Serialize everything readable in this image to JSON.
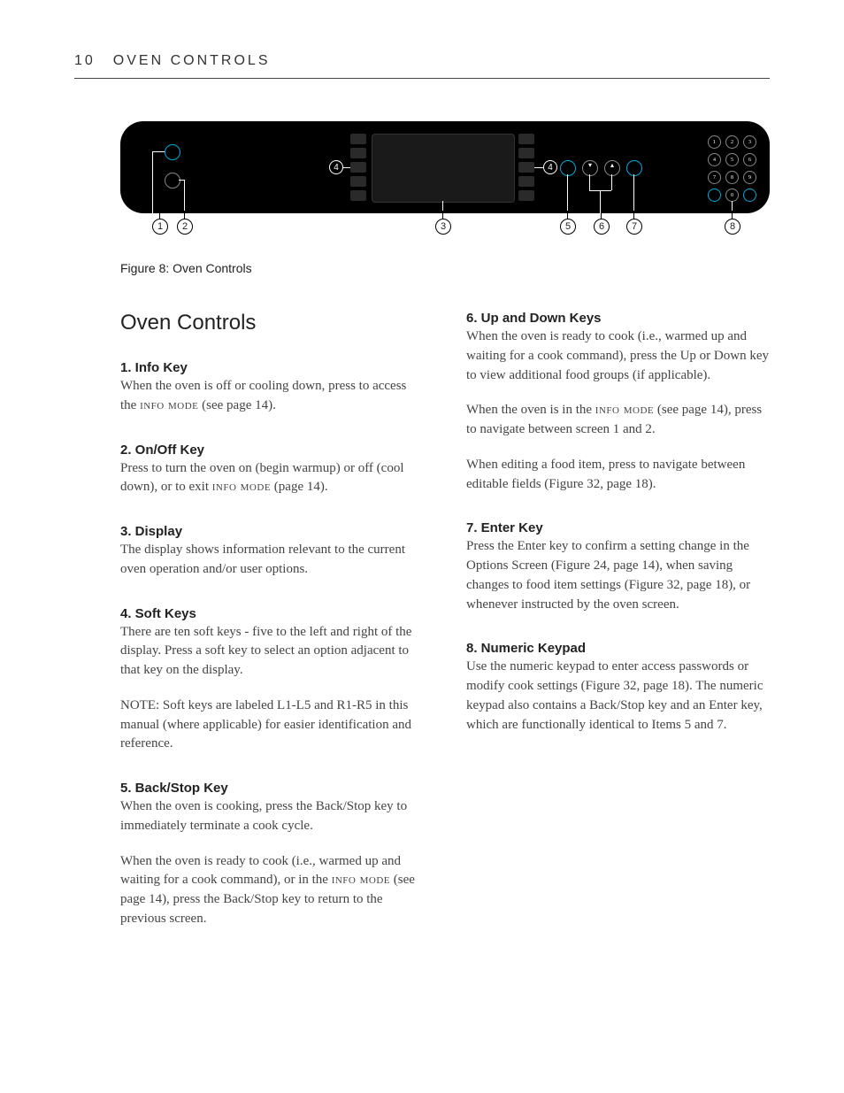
{
  "header": {
    "page_number": "10",
    "section": "OVEN CONTROLS"
  },
  "figure": {
    "caption": "Figure 8: Oven Controls",
    "callouts": [
      "1",
      "2",
      "3",
      "4",
      "4",
      "5",
      "6",
      "7",
      "8"
    ],
    "keypad": [
      "1",
      "2",
      "3",
      "4",
      "5",
      "6",
      "7",
      "8",
      "9",
      "",
      "0",
      ""
    ]
  },
  "title": "Oven Controls",
  "left": [
    {
      "head": "1. Info Key",
      "paras": [
        "When the oven is off or cooling down, press to access the INFO MODE (see page 14)."
      ]
    },
    {
      "head": "2. On/Off Key",
      "paras": [
        "Press to turn the oven on (begin warmup) or off (cool down), or to exit INFO MODE (page 14)."
      ]
    },
    {
      "head": "3. Display",
      "paras": [
        "The display shows information relevant to the current oven operation and/or user options."
      ]
    },
    {
      "head": "4. Soft Keys",
      "paras": [
        "There are ten soft keys - five to the left and right of the display. Press a soft key to select an option adjacent to that key on the display.",
        "NOTE: Soft keys are labeled L1-L5 and R1-R5 in this manual (where applicable) for easier identification and reference."
      ]
    },
    {
      "head": "5. Back/Stop Key",
      "paras": [
        "When the oven is cooking, press the Back/Stop key to immediately terminate a cook cycle.",
        "When the oven is ready to cook (i.e., warmed up and waiting for a cook command), or in the INFO MODE (see page 14), press the Back/Stop key to return to the previous screen."
      ]
    }
  ],
  "right": [
    {
      "head": "6. Up and Down Keys",
      "paras": [
        "When the oven is ready to cook (i.e., warmed up and waiting for a cook command), press the Up or Down key to view additional food groups (if applicable).",
        "When the oven is in the INFO MODE (see page 14), press to navigate between screen 1 and 2.",
        "When editing a food item, press to navigate between editable fields (Figure 32, page 18)."
      ]
    },
    {
      "head": "7. Enter Key",
      "paras": [
        "Press the Enter key to confirm a setting change in the Options Screen (Figure 24, page 14), when saving changes to food item settings (Figure 32, page 18), or whenever instructed by the oven screen."
      ]
    },
    {
      "head": "8. Numeric Keypad",
      "paras": [
        "Use the numeric keypad to enter access passwords or modify cook settings (Figure 32, page 18). The numeric keypad also contains a Back/Stop key and an Enter key, which are functionally identical to Items 5 and 7."
      ]
    }
  ]
}
